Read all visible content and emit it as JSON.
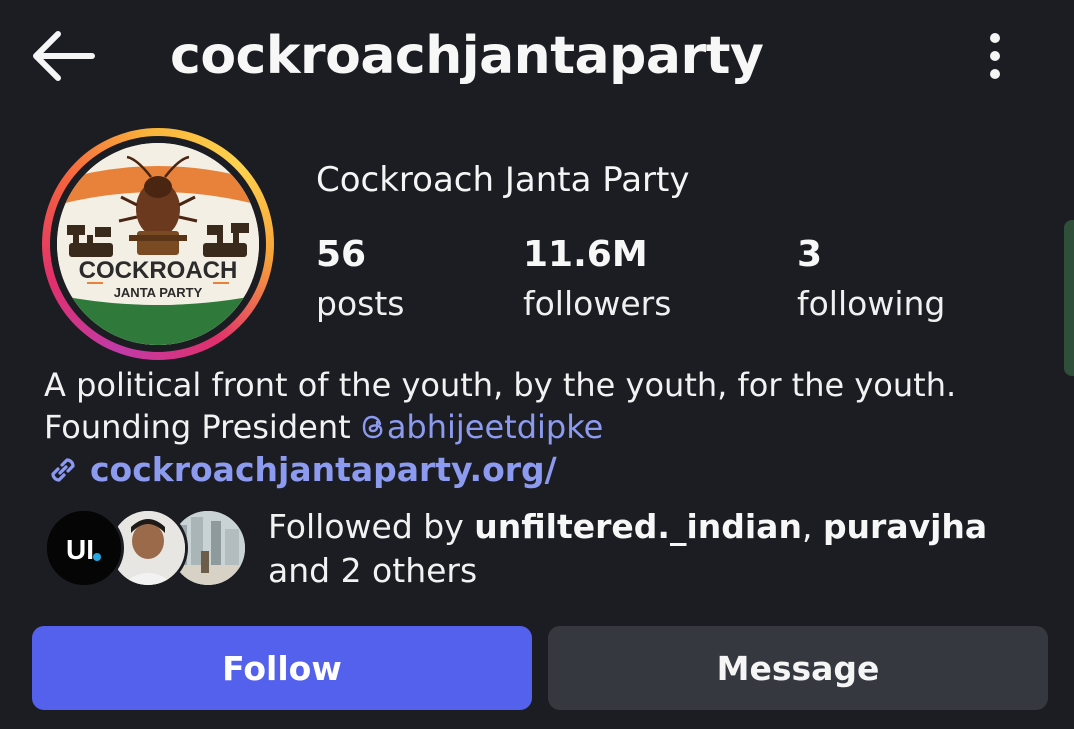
{
  "header": {
    "username": "cockroachjantaparty",
    "back_icon": "arrow-left-icon",
    "more_icon": "more-vertical-icon"
  },
  "profile": {
    "display_name": "Cockroach Janta Party",
    "avatar_text": {
      "line1": "COCKROACH",
      "line2": "JANTA PARTY"
    },
    "stats": [
      {
        "value": "56",
        "label": "posts"
      },
      {
        "value": "11.6M",
        "label": "followers"
      },
      {
        "value": "3",
        "label": "following"
      }
    ]
  },
  "bio": {
    "line1": "A political front of the youth, by the youth, for the youth.",
    "line2_prefix": "Founding President ",
    "mention": "abhijeetdipke",
    "link": "cockroachjantaparty.org/"
  },
  "followed_by": {
    "prefix": "Followed by ",
    "user1": "unfiltered._indian",
    "separator": ", ",
    "user2": "puravjha",
    "suffix": " and 2 others",
    "mini_avatar_1_text": "UI"
  },
  "buttons": {
    "follow": "Follow",
    "message": "Message"
  },
  "colors": {
    "background": "#1c1d22",
    "accent_link": "#8c9bf0",
    "follow_button": "#5461ec",
    "message_button": "#363840"
  }
}
